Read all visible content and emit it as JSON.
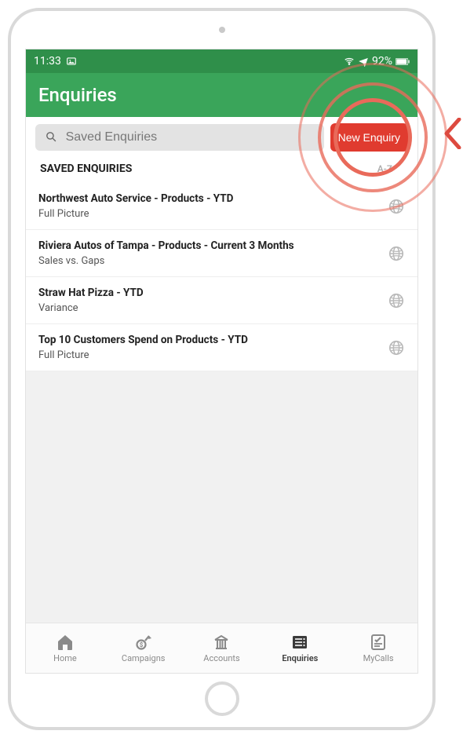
{
  "statusbar": {
    "time": "11:33",
    "battery": "92%"
  },
  "header": {
    "title": "Enquiries"
  },
  "search": {
    "placeholder": "Saved Enquiries"
  },
  "actions": {
    "new_enquiry_label": "New Enquiry"
  },
  "section": {
    "title": "SAVED ENQUIRIES",
    "sort_label": "A-Z"
  },
  "enquiries": [
    {
      "title": "Northwest Auto Service - Products - YTD",
      "subtitle": "Full Picture"
    },
    {
      "title": "Riviera Autos of Tampa - Products - Current 3 Months",
      "subtitle": "Sales vs. Gaps"
    },
    {
      "title": "Straw Hat Pizza - YTD",
      "subtitle": "Variance"
    },
    {
      "title": "Top 10 Customers Spend on Products - YTD",
      "subtitle": "Full Picture"
    }
  ],
  "nav": {
    "items": [
      {
        "label": "Home",
        "icon": "home"
      },
      {
        "label": "Campaigns",
        "icon": "campaigns"
      },
      {
        "label": "Accounts",
        "icon": "accounts"
      },
      {
        "label": "Enquiries",
        "icon": "enquiries",
        "active": true
      },
      {
        "label": "MyCalls",
        "icon": "mycalls"
      }
    ]
  }
}
